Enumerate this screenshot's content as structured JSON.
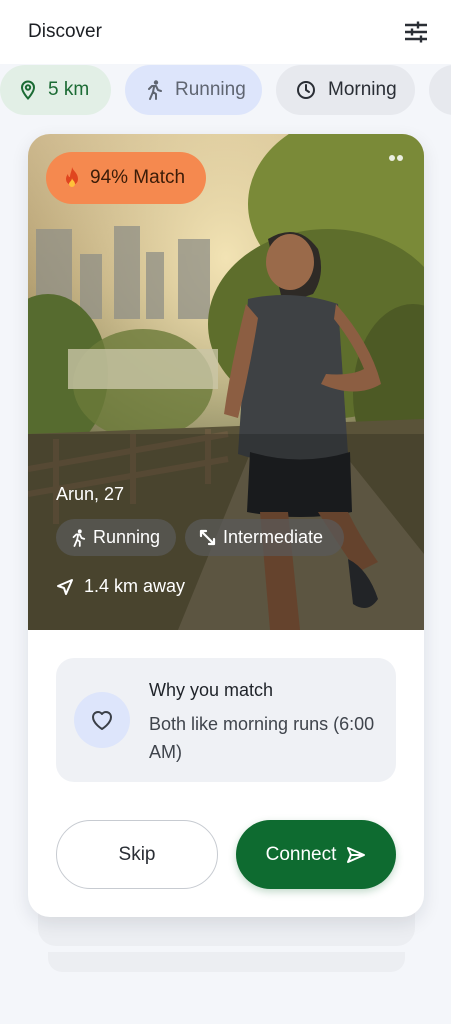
{
  "header": {
    "title": "Discover",
    "filter_icon": "tune-icon"
  },
  "chips": [
    {
      "label": "5 km",
      "icon": "location-pin-icon",
      "color": "#1b6b34"
    },
    {
      "label": "Running",
      "icon": "running-icon",
      "color": "#5f6571"
    },
    {
      "label": "Morning",
      "icon": "clock-icon",
      "color": "#2a2e35"
    }
  ],
  "card": {
    "match_badge": "94% Match",
    "badge_color": "#f5894f",
    "name_age": "Arun, 27",
    "tags": [
      {
        "label": "Running",
        "icon": "running-icon"
      },
      {
        "label": "Intermediate",
        "icon": "expand-icon"
      }
    ],
    "distance": "1.4 km away",
    "why_title": "Why you match",
    "why_desc": "Both like morning runs (6:00 AM)",
    "skip_label": "Skip",
    "connect_label": "Connect",
    "connect_color": "#0e6b30"
  }
}
